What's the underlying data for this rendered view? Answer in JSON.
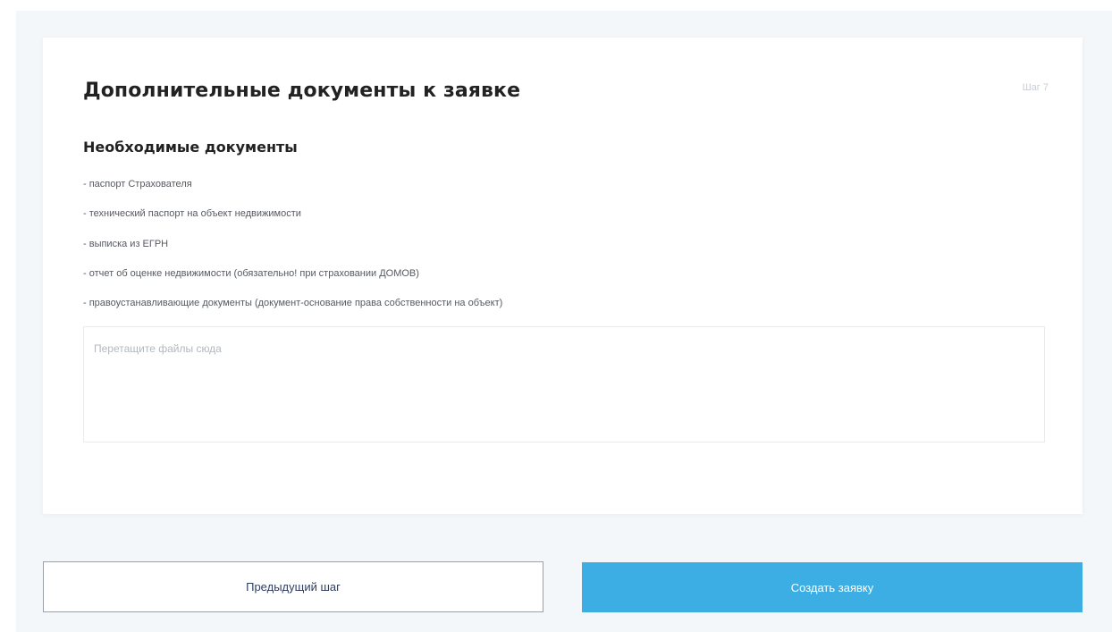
{
  "card": {
    "title": "Дополнительные документы к заявке",
    "step_label": "Шаг 7",
    "section_title": "Необходимые документы",
    "documents": [
      "- паспорт Страхователя",
      "- технический паспорт на объект недвижимости",
      "- выписка из ЕГРН",
      "- отчет об оценке недвижимости (обязательно! при страховании ДОМОВ)",
      "- правоустанавливающие документы (документ-основание права собственности на объект)"
    ],
    "dropzone_hint": "Перетащите файлы сюда"
  },
  "actions": {
    "prev_label": "Предыдущий шаг",
    "create_label": "Создать заявку"
  },
  "colors": {
    "accent": "#3daee4",
    "page_background": "#f4f7f9"
  }
}
